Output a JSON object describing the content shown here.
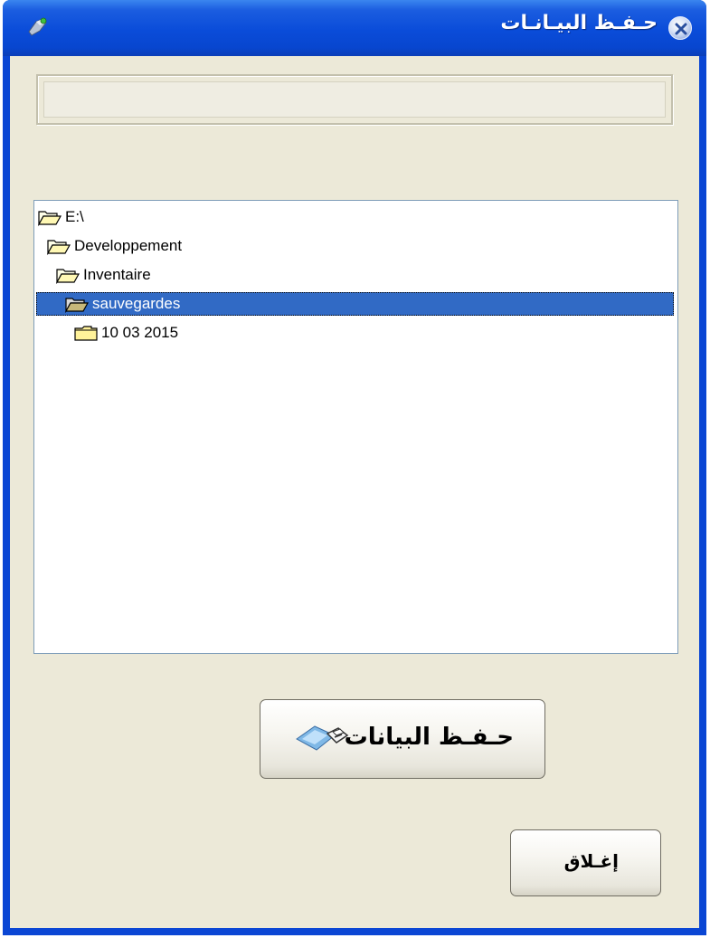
{
  "window": {
    "title": "حـفـظ البيـانـات",
    "path_value": ""
  },
  "tree": {
    "nodes": [
      {
        "label": "E:\\",
        "state": "open",
        "selected": false
      },
      {
        "label": "Developpement",
        "state": "open",
        "selected": false
      },
      {
        "label": "Inventaire",
        "state": "open",
        "selected": false
      },
      {
        "label": "sauvegardes",
        "state": "open",
        "selected": true
      },
      {
        "label": "10 03 2015",
        "state": "closed",
        "selected": false
      }
    ]
  },
  "buttons": {
    "save_label": "حـفـظ البيانات",
    "close_label": "إغـلاق"
  },
  "icons": {
    "app": "app-icon",
    "close": "close-icon",
    "folder_open": "folder-open-icon",
    "folder_closed": "folder-closed-icon",
    "save": "save-disk-icon"
  },
  "colors": {
    "titlebar": "#0a4cd9",
    "selection": "#316ac5",
    "window_bg": "#ece9d8"
  }
}
